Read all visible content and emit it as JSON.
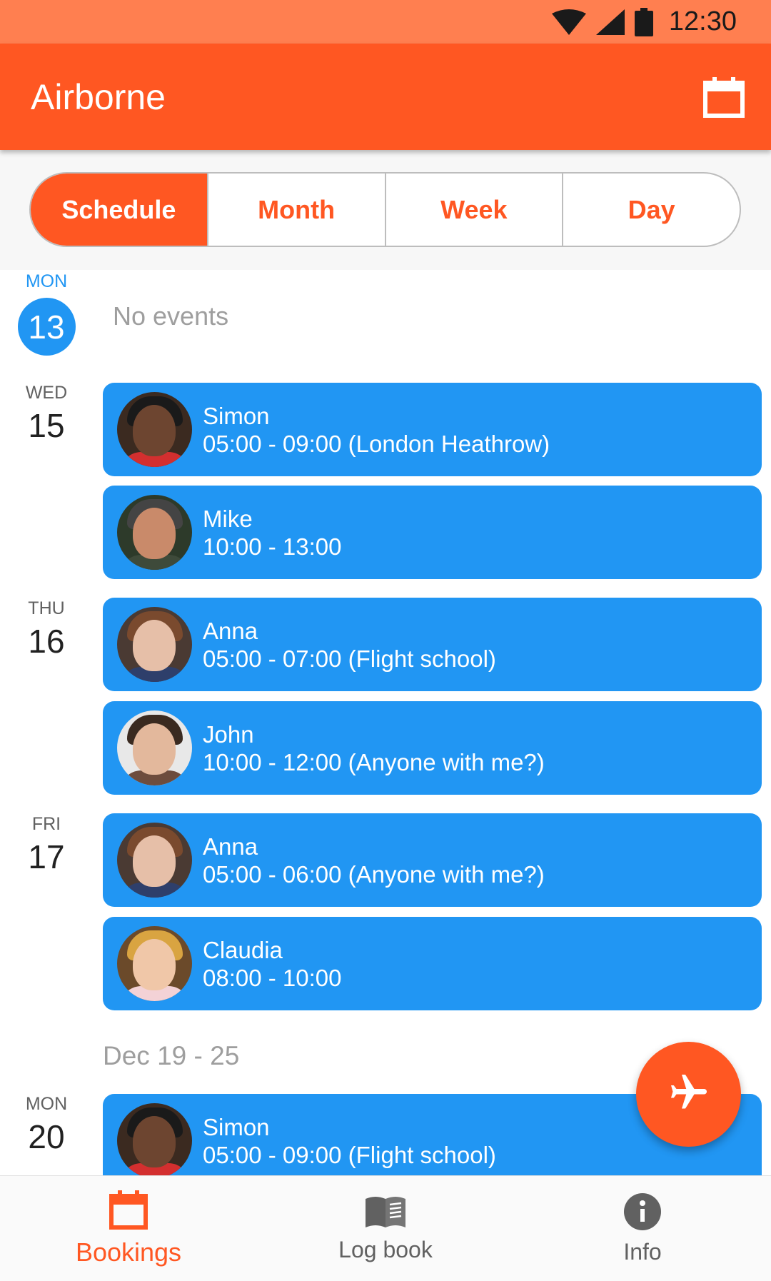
{
  "status_bar": {
    "time": "12:30",
    "icons": [
      "wifi-icon",
      "cell-signal-icon",
      "battery-icon"
    ]
  },
  "app_bar": {
    "title": "Airborne",
    "action_icon": "calendar-icon"
  },
  "view_tabs": [
    {
      "label": "Schedule",
      "selected": true
    },
    {
      "label": "Month",
      "selected": false
    },
    {
      "label": "Week",
      "selected": false
    },
    {
      "label": "Day",
      "selected": false
    }
  ],
  "schedule": {
    "days": [
      {
        "dow": "MON",
        "num": "13",
        "today": true,
        "no_events": "No events"
      },
      {
        "dow": "WED",
        "num": "15"
      },
      {
        "dow": "THU",
        "num": "16"
      },
      {
        "dow": "FRI",
        "num": "17"
      },
      {
        "dow": "MON",
        "num": "20"
      }
    ],
    "week_range": "Dec 19 - 25",
    "events": [
      {
        "name": "Simon",
        "time": "05:00 - 09:00 (London Heathrow)"
      },
      {
        "name": "Mike",
        "time": "10:00 - 13:00"
      },
      {
        "name": "Anna",
        "time": "05:00 - 07:00 (Flight school)"
      },
      {
        "name": "John",
        "time": "10:00 - 12:00 (Anyone with me?)"
      },
      {
        "name": "Anna",
        "time": "05:00 - 06:00 (Anyone with me?)"
      },
      {
        "name": "Claudia",
        "time": "08:00 - 10:00"
      },
      {
        "name": "Simon",
        "time": "05:00 - 09:00 (Flight school)"
      }
    ]
  },
  "fab": {
    "icon": "airplane-icon"
  },
  "bottom_nav": [
    {
      "label": "Bookings",
      "icon": "calendar-icon",
      "active": true
    },
    {
      "label": "Log book",
      "icon": "book-icon",
      "active": false
    },
    {
      "label": "Info",
      "icon": "info-icon",
      "active": false
    }
  ],
  "colors": {
    "primary": "#ff5722",
    "status_bar": "#ff7f50",
    "event_card": "#2196f3",
    "today": "#2196f3"
  }
}
